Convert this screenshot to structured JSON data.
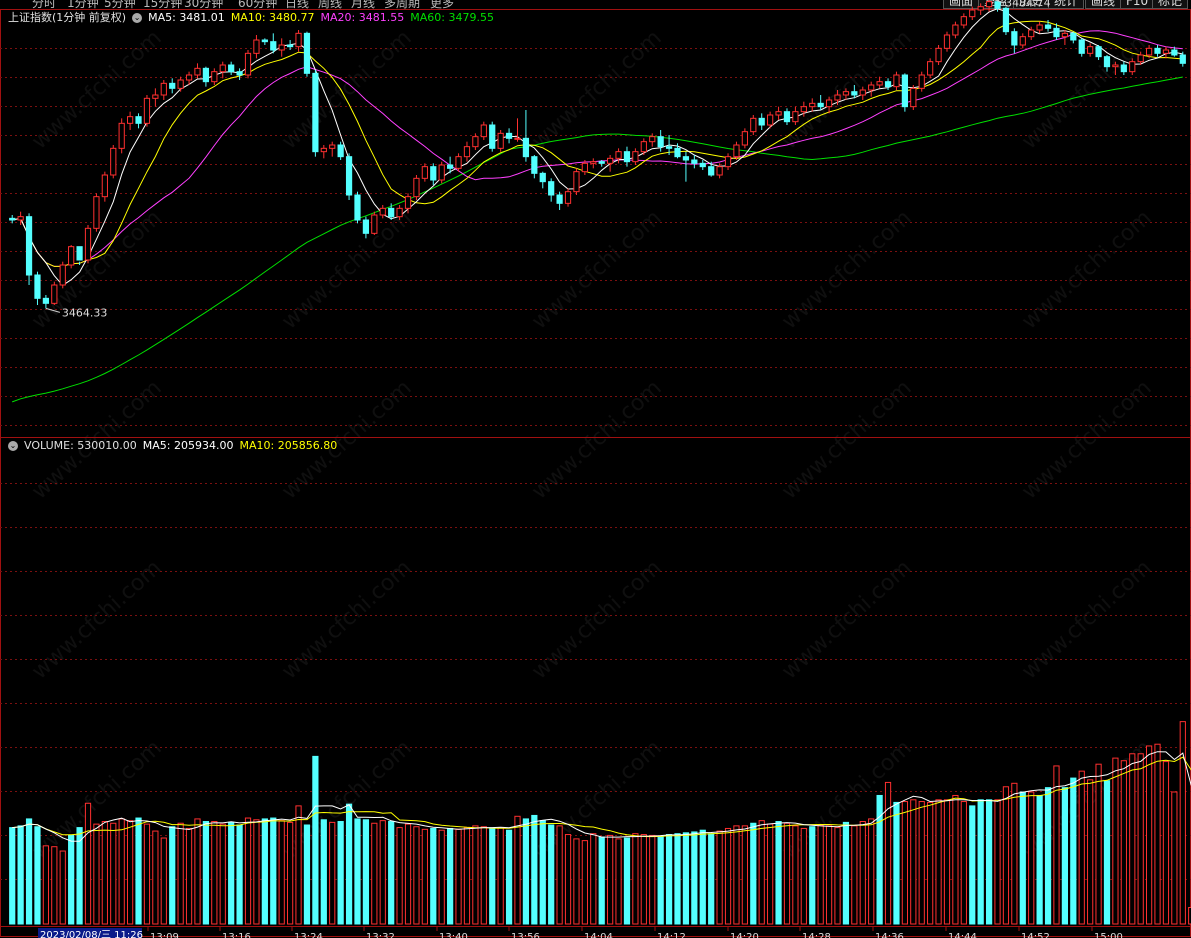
{
  "window": {
    "period_tabs": [
      "分时",
      "1分钟",
      "5分钟",
      "15分钟",
      "30分钟",
      "60分钟",
      "日线",
      "周线",
      "月线",
      "多周期",
      "更多"
    ],
    "buttons": [
      "画面",
      "复盘",
      "历史",
      "统计",
      "画线",
      "F10",
      "标记"
    ]
  },
  "price_panel": {
    "name": "上证指数(1分钟 前复权)",
    "ma5_label": "MA5:",
    "ma5": "3481.01",
    "ma10_label": "MA10:",
    "ma10": "3480.77",
    "ma20_label": "MA20:",
    "ma20": "3481.55",
    "ma60_label": "MA60:",
    "ma60": "3479.55",
    "high_label": "3484.74",
    "low_label": "3464.33"
  },
  "volume_panel": {
    "vol_label": "VOLUME:",
    "vol": "530010.00",
    "ma5_label": "MA5:",
    "ma5": "205934.00",
    "ma10_label": "MA10:",
    "ma10": "205856.80"
  },
  "time_axis": {
    "current": "2023/02/08/三 11:26",
    "ticks": [
      "13:09",
      "13:16",
      "13:24",
      "13:32",
      "13:40",
      "13:56",
      "14:04",
      "14:12",
      "14:20",
      "14:28",
      "14:36",
      "14:44",
      "14:52",
      "15:00"
    ]
  },
  "watermark": "www.cfchi.com",
  "colors": {
    "up": "#ff3030",
    "down": "#54ffff",
    "ma5": "#ffffff",
    "ma10": "#ffff00",
    "ma20": "#ff40ff",
    "ma60": "#00e000",
    "grid": "#7a1010",
    "border": "#a01010"
  },
  "chart_data": {
    "type": "candlestick",
    "price_range": [
      3462.5,
      3486.5
    ],
    "candles": [
      [
        3475.2,
        3475.4,
        3474.9,
        3475.1
      ],
      [
        3475.1,
        3475.6,
        3474.8,
        3475.3
      ],
      [
        3475.3,
        3475.5,
        3471.2,
        3471.8
      ],
      [
        3471.8,
        3472.0,
        3470.0,
        3470.4
      ],
      [
        3470.4,
        3470.6,
        3469.8,
        3470.1
      ],
      [
        3470.1,
        3471.4,
        3470.0,
        3471.2
      ],
      [
        3471.2,
        3472.6,
        3471.0,
        3472.4
      ],
      [
        3472.4,
        3473.6,
        3472.2,
        3473.5
      ],
      [
        3473.5,
        3472.6,
        3472.4,
        3472.7
      ],
      [
        3472.7,
        3474.8,
        3472.5,
        3474.6
      ],
      [
        3474.6,
        3476.7,
        3474.4,
        3476.5
      ],
      [
        3476.5,
        3478.0,
        3476.2,
        3477.8
      ],
      [
        3477.8,
        3479.6,
        3477.6,
        3479.4
      ],
      [
        3479.4,
        3481.2,
        3479.1,
        3480.9
      ],
      [
        3480.9,
        3481.6,
        3480.5,
        3481.3
      ],
      [
        3481.3,
        3481.5,
        3480.6,
        3480.9
      ],
      [
        3480.9,
        3482.6,
        3480.7,
        3482.4
      ],
      [
        3482.4,
        3483.0,
        3481.9,
        3482.6
      ],
      [
        3482.6,
        3483.5,
        3482.3,
        3483.3
      ],
      [
        3483.3,
        3483.6,
        3482.7,
        3483.0
      ],
      [
        3483.0,
        3483.7,
        3482.8,
        3483.5
      ],
      [
        3483.5,
        3484.0,
        3483.2,
        3483.8
      ],
      [
        3483.8,
        3484.5,
        3483.6,
        3484.2
      ],
      [
        3484.2,
        3484.3,
        3483.1,
        3483.4
      ],
      [
        3483.4,
        3484.2,
        3483.2,
        3484.0
      ],
      [
        3484.0,
        3484.6,
        3483.6,
        3484.4
      ],
      [
        3484.4,
        3484.6,
        3483.8,
        3484.0
      ],
      [
        3484.0,
        3484.2,
        3483.5,
        3483.8
      ],
      [
        3483.8,
        3485.3,
        3483.6,
        3485.1
      ],
      [
        3485.1,
        3486.2,
        3484.8,
        3485.9
      ],
      [
        3485.9,
        3486.0,
        3485.6,
        3485.8
      ],
      [
        3485.8,
        3486.3,
        3485.1,
        3485.3
      ],
      [
        3485.3,
        3486.0,
        3484.9,
        3485.6
      ],
      [
        3485.6,
        3485.9,
        3485.3,
        3485.5
      ],
      [
        3485.5,
        3486.5,
        3485.2,
        3486.3
      ],
      [
        3486.3,
        3486.4,
        3483.7,
        3483.9
      ],
      [
        3483.9,
        3484.1,
        3478.9,
        3479.2
      ],
      [
        3479.2,
        3479.6,
        3478.8,
        3479.4
      ],
      [
        3479.4,
        3479.8,
        3478.9,
        3479.6
      ],
      [
        3479.6,
        3479.8,
        3478.7,
        3478.9
      ],
      [
        3478.9,
        3479.1,
        3476.3,
        3476.6
      ],
      [
        3476.6,
        3476.8,
        3474.9,
        3475.1
      ],
      [
        3475.1,
        3475.3,
        3474.0,
        3474.3
      ],
      [
        3474.3,
        3475.6,
        3474.2,
        3475.4
      ],
      [
        3475.4,
        3476.0,
        3475.2,
        3475.8
      ],
      [
        3475.8,
        3476.1,
        3475.1,
        3475.3
      ],
      [
        3475.3,
        3476.0,
        3475.1,
        3475.8
      ],
      [
        3475.8,
        3476.7,
        3475.5,
        3476.5
      ],
      [
        3476.5,
        3477.8,
        3476.3,
        3477.6
      ],
      [
        3477.6,
        3478.5,
        3477.4,
        3478.3
      ],
      [
        3478.3,
        3478.5,
        3477.2,
        3477.5
      ],
      [
        3477.5,
        3478.6,
        3477.3,
        3478.4
      ],
      [
        3478.4,
        3478.9,
        3477.9,
        3478.2
      ],
      [
        3478.2,
        3479.1,
        3478.0,
        3478.9
      ],
      [
        3478.9,
        3479.8,
        3478.6,
        3479.5
      ],
      [
        3479.5,
        3480.3,
        3479.3,
        3480.1
      ],
      [
        3480.1,
        3481.0,
        3479.9,
        3480.8
      ],
      [
        3480.8,
        3481.0,
        3479.2,
        3479.4
      ],
      [
        3479.4,
        3480.5,
        3479.2,
        3480.3
      ],
      [
        3480.3,
        3480.6,
        3479.7,
        3480.0
      ],
      [
        3480.0,
        3481.2,
        3479.8,
        3480.0
      ],
      [
        3480.0,
        3481.7,
        3478.6,
        3478.9
      ],
      [
        3478.9,
        3479.0,
        3477.6,
        3477.9
      ],
      [
        3477.9,
        3478.0,
        3477.0,
        3477.4
      ],
      [
        3477.4,
        3477.6,
        3476.2,
        3476.6
      ],
      [
        3476.6,
        3476.8,
        3475.7,
        3476.1
      ],
      [
        3476.1,
        3477.0,
        3475.9,
        3476.8
      ],
      [
        3476.8,
        3478.2,
        3476.6,
        3478.0
      ],
      [
        3478.0,
        3478.7,
        3477.8,
        3478.5
      ],
      [
        3478.5,
        3478.8,
        3478.2,
        3478.6
      ],
      [
        3478.6,
        3478.7,
        3478.3,
        3478.5
      ],
      [
        3478.5,
        3479.0,
        3478.0,
        3478.8
      ],
      [
        3478.8,
        3479.4,
        3478.5,
        3479.2
      ],
      [
        3479.2,
        3479.5,
        3478.3,
        3478.6
      ],
      [
        3478.6,
        3479.4,
        3478.4,
        3479.2
      ],
      [
        3479.2,
        3480.0,
        3479.0,
        3479.8
      ],
      [
        3479.8,
        3480.3,
        3479.5,
        3480.1
      ],
      [
        3480.1,
        3480.5,
        3479.2,
        3479.5
      ],
      [
        3479.5,
        3480.2,
        3479.0,
        3479.4
      ],
      [
        3479.4,
        3479.7,
        3478.8,
        3478.9
      ],
      [
        3478.9,
        3479.2,
        3477.4,
        3478.7
      ],
      [
        3478.7,
        3479.0,
        3478.2,
        3478.5
      ],
      [
        3478.5,
        3478.7,
        3478.1,
        3478.3
      ],
      [
        3478.3,
        3478.6,
        3477.7,
        3477.8
      ],
      [
        3477.8,
        3478.5,
        3477.6,
        3478.3
      ],
      [
        3478.3,
        3479.1,
        3478.1,
        3478.9
      ],
      [
        3478.9,
        3479.8,
        3478.7,
        3479.6
      ],
      [
        3479.6,
        3480.6,
        3479.4,
        3480.4
      ],
      [
        3480.4,
        3481.4,
        3480.2,
        3481.2
      ],
      [
        3481.2,
        3481.5,
        3480.5,
        3480.8
      ],
      [
        3480.8,
        3481.6,
        3480.6,
        3481.4
      ],
      [
        3481.4,
        3481.9,
        3481.1,
        3481.6
      ],
      [
        3481.6,
        3481.8,
        3480.8,
        3481.0
      ],
      [
        3481.0,
        3481.9,
        3480.8,
        3481.6
      ],
      [
        3481.6,
        3482.2,
        3481.3,
        3481.9
      ],
      [
        3481.9,
        3482.4,
        3481.6,
        3482.1
      ],
      [
        3482.1,
        3482.6,
        3481.7,
        3481.9
      ],
      [
        3481.9,
        3482.5,
        3481.5,
        3482.3
      ],
      [
        3482.3,
        3482.9,
        3482.0,
        3482.6
      ],
      [
        3482.6,
        3483.0,
        3482.3,
        3482.8
      ],
      [
        3482.8,
        3483.2,
        3482.4,
        3482.6
      ],
      [
        3482.6,
        3483.1,
        3482.3,
        3482.9
      ],
      [
        3482.9,
        3483.4,
        3482.5,
        3483.2
      ],
      [
        3483.2,
        3483.7,
        3483.0,
        3483.4
      ],
      [
        3483.4,
        3483.6,
        3482.9,
        3483.1
      ],
      [
        3483.1,
        3484.0,
        3482.9,
        3483.8
      ],
      [
        3483.8,
        3483.9,
        3481.6,
        3481.9
      ],
      [
        3481.9,
        3483.2,
        3481.7,
        3483.0
      ],
      [
        3483.0,
        3484.0,
        3482.8,
        3483.8
      ],
      [
        3483.8,
        3484.8,
        3483.6,
        3484.6
      ],
      [
        3484.6,
        3485.6,
        3484.4,
        3485.4
      ],
      [
        3485.4,
        3486.4,
        3485.2,
        3486.2
      ],
      [
        3486.2,
        3487.0,
        3486.0,
        3486.8
      ],
      [
        3486.8,
        3487.5,
        3486.6,
        3487.3
      ],
      [
        3487.3,
        3487.9,
        3487.1,
        3487.7
      ],
      [
        3487.7,
        3488.1,
        3487.4,
        3487.9
      ],
      [
        3487.9,
        3488.4,
        3487.6,
        3488.2
      ],
      [
        3488.2,
        3488.3,
        3487.6,
        3487.8
      ],
      [
        3487.8,
        3487.9,
        3486.2,
        3486.4
      ],
      [
        3486.4,
        3486.6,
        3485.1,
        3485.6
      ],
      [
        3485.6,
        3486.3,
        3485.4,
        3486.1
      ],
      [
        3486.1,
        3486.7,
        3485.9,
        3486.5
      ],
      [
        3486.5,
        3487.0,
        3486.3,
        3486.8
      ],
      [
        3486.8,
        3487.1,
        3486.4,
        3486.6
      ],
      [
        3486.6,
        3486.9,
        3485.9,
        3486.1
      ],
      [
        3486.1,
        3486.5,
        3485.6,
        3486.3
      ],
      [
        3486.3,
        3486.4,
        3485.7,
        3485.9
      ],
      [
        3485.9,
        3486.0,
        3484.9,
        3485.1
      ],
      [
        3485.1,
        3485.7,
        3484.9,
        3485.5
      ],
      [
        3485.5,
        3485.6,
        3484.7,
        3484.9
      ],
      [
        3484.9,
        3485.0,
        3484.0,
        3484.3
      ],
      [
        3484.3,
        3484.6,
        3483.8,
        3484.4
      ],
      [
        3484.4,
        3484.6,
        3483.8,
        3484.0
      ],
      [
        3484.0,
        3484.8,
        3483.8,
        3484.6
      ],
      [
        3484.6,
        3485.2,
        3484.4,
        3485.0
      ],
      [
        3485.0,
        3485.6,
        3484.8,
        3485.4
      ],
      [
        3485.4,
        3485.6,
        3484.9,
        3485.1
      ],
      [
        3485.1,
        3485.5,
        3484.8,
        3485.3
      ],
      [
        3485.3,
        3485.5,
        3484.9,
        3485.0
      ],
      [
        3485.0,
        3485.2,
        3484.3,
        3484.5
      ]
    ],
    "volume_range": [
      0,
      540000
    ],
    "volumes": [
      111000,
      113000,
      121000,
      112000,
      90000,
      89000,
      84000,
      102000,
      111000,
      139000,
      115000,
      118000,
      116000,
      121000,
      119000,
      122000,
      115000,
      107000,
      99000,
      112000,
      116000,
      110000,
      121000,
      118000,
      118000,
      115000,
      117000,
      114000,
      122000,
      120000,
      121000,
      122000,
      119000,
      117000,
      136000,
      114000,
      193000,
      120000,
      117000,
      118000,
      138000,
      121000,
      120000,
      116000,
      119000,
      118000,
      111000,
      115000,
      112000,
      109000,
      110000,
      108000,
      110000,
      109000,
      111000,
      113000,
      112000,
      110000,
      111000,
      108000,
      124000,
      121000,
      125000,
      119000,
      114000,
      113000,
      103000,
      98000,
      96000,
      104000,
      100000,
      102000,
      98000,
      99000,
      104000,
      103000,
      102000,
      101000,
      103000,
      104000,
      105000,
      106000,
      108000,
      104000,
      107000,
      110000,
      113000,
      113000,
      116000,
      119000,
      115000,
      118000,
      116000,
      113000,
      110000,
      112000,
      114000,
      113000,
      111000,
      117000,
      113000,
      118000,
      121000,
      148000,
      163000,
      140000,
      141000,
      143000,
      141000,
      140000,
      143000,
      143000,
      148000,
      141000,
      136000,
      143000,
      143000,
      143000,
      158000,
      162000,
      152000,
      152000,
      148000,
      157000,
      182000,
      157000,
      168000,
      176000,
      166000,
      184000,
      165000,
      191000,
      188000,
      196000,
      196000,
      205000,
      207000,
      187000,
      152000,
      233000,
      19000,
      530010
    ],
    "volume_colors_up": [
      false,
      false,
      false,
      false,
      true,
      true,
      true,
      false,
      false,
      true,
      true,
      true,
      true,
      true,
      true,
      false,
      true,
      true,
      true,
      false,
      true,
      true,
      true,
      false,
      true,
      true,
      false,
      false,
      true,
      true,
      false,
      false,
      true,
      true,
      true,
      false,
      false,
      false,
      true,
      false,
      false,
      false,
      false,
      true,
      true,
      false,
      true,
      true,
      true,
      true,
      false,
      true,
      false,
      true,
      true,
      true,
      true,
      false,
      true,
      false,
      true,
      false,
      false,
      false,
      false,
      true,
      true,
      true,
      true,
      true,
      false,
      true,
      true,
      false,
      true,
      true,
      true,
      false,
      false,
      false,
      false,
      false,
      false,
      false,
      true,
      true,
      true,
      true,
      false,
      true,
      true,
      false,
      true,
      true,
      true,
      false,
      true,
      true,
      true,
      false,
      true,
      true,
      true,
      false,
      true,
      false,
      true,
      true,
      true,
      true,
      true,
      true,
      true,
      true,
      false,
      false,
      false,
      true,
      true,
      true,
      false,
      true,
      false,
      false,
      true,
      false,
      false,
      true,
      true,
      true,
      false,
      true,
      true,
      true,
      true,
      true,
      true,
      true,
      true,
      true,
      true,
      false
    ]
  }
}
